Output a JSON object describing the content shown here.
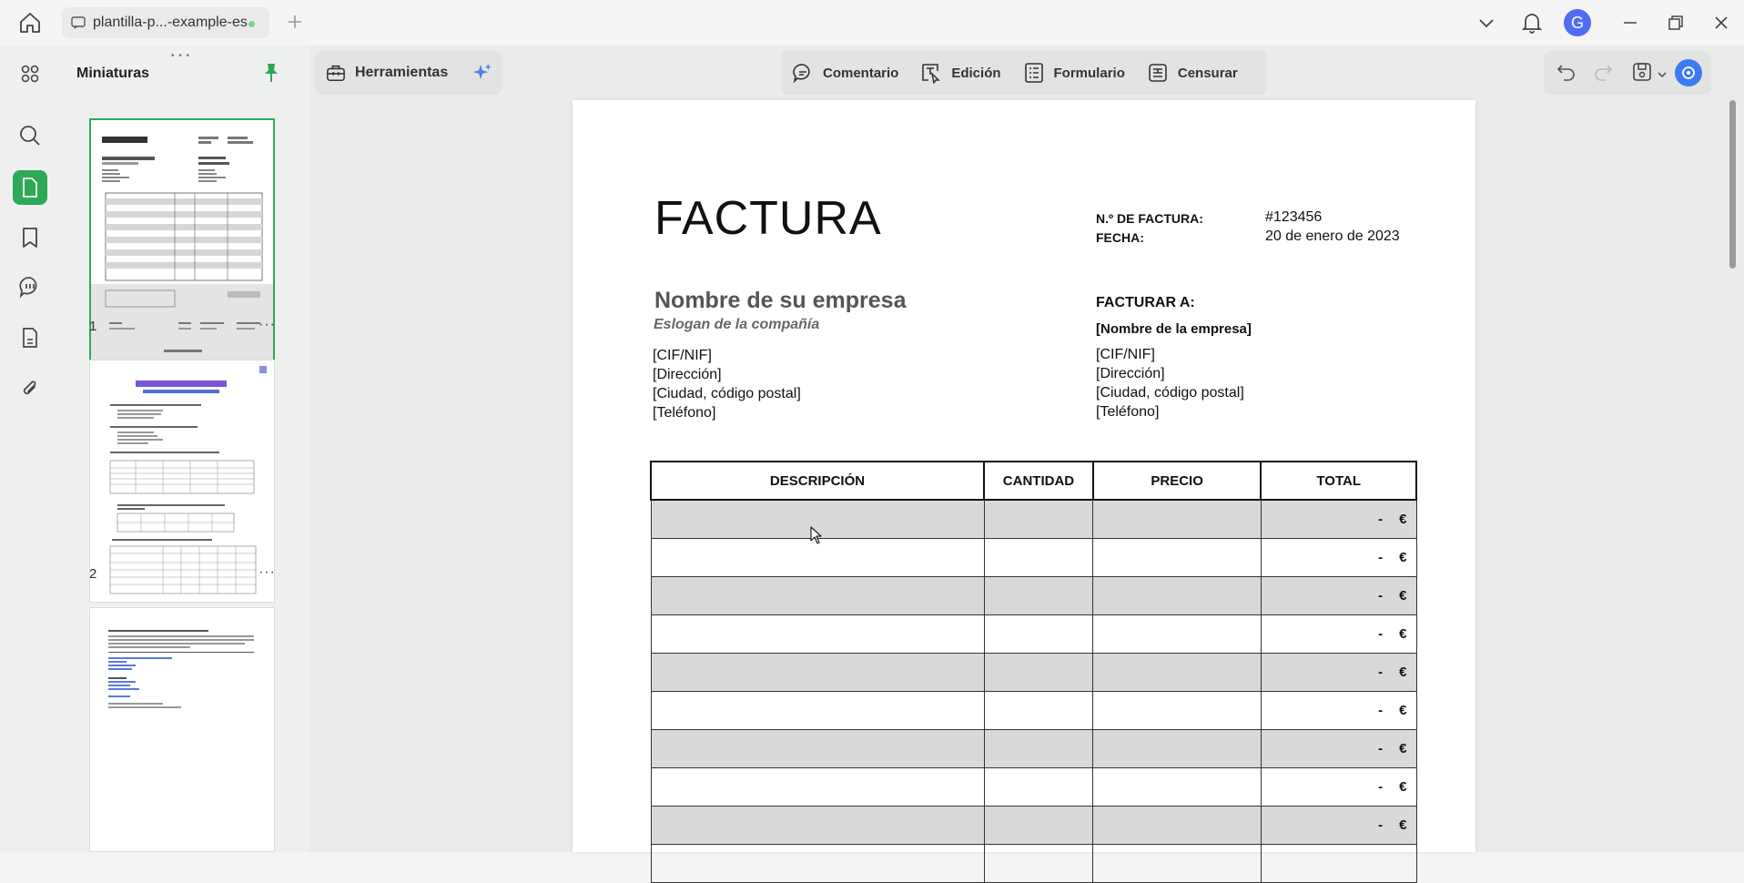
{
  "titlebar": {
    "tab_label": "plantilla-p...-example-es",
    "avatar_letter": "G"
  },
  "thumbnails": {
    "title": "Miniaturas",
    "pages": [
      {
        "number": "1"
      },
      {
        "number": "2"
      }
    ],
    "more": "···"
  },
  "toolbar": {
    "tools_label": "Herramientas",
    "modes": [
      {
        "label": "Comentario",
        "icon": "comment-icon"
      },
      {
        "label": "Edición",
        "icon": "edit-icon"
      },
      {
        "label": "Formulario",
        "icon": "form-icon"
      },
      {
        "label": "Censurar",
        "icon": "redact-icon"
      }
    ]
  },
  "invoice": {
    "title": "FACTURA",
    "number_label": "N.º DE FACTURA:",
    "number_value": "#123456",
    "date_label": "FECHA:",
    "date_value": "20 de enero de 2023",
    "company_name": "Nombre de su empresa",
    "slogan": "Eslogan de la compañía",
    "sender_lines": [
      "[CIF/NIF]",
      "[Dirección]",
      "[Ciudad, código postal]",
      "[Teléfono]"
    ],
    "bill_to_label": "FACTURAR A:",
    "bill_to_name": "[Nombre de la empresa]",
    "bill_to_lines": [
      "[CIF/NIF]",
      "[Dirección]",
      "[Ciudad, código postal]",
      "[Teléfono]"
    ],
    "table": {
      "headers": [
        "DESCRIPCIÓN",
        "CANTIDAD",
        "PRECIO",
        "TOTAL"
      ],
      "row_dash": "-",
      "row_currency": "€"
    }
  },
  "colors": {
    "accent": "#2daa55",
    "row_gray": "#d9d9d9"
  }
}
